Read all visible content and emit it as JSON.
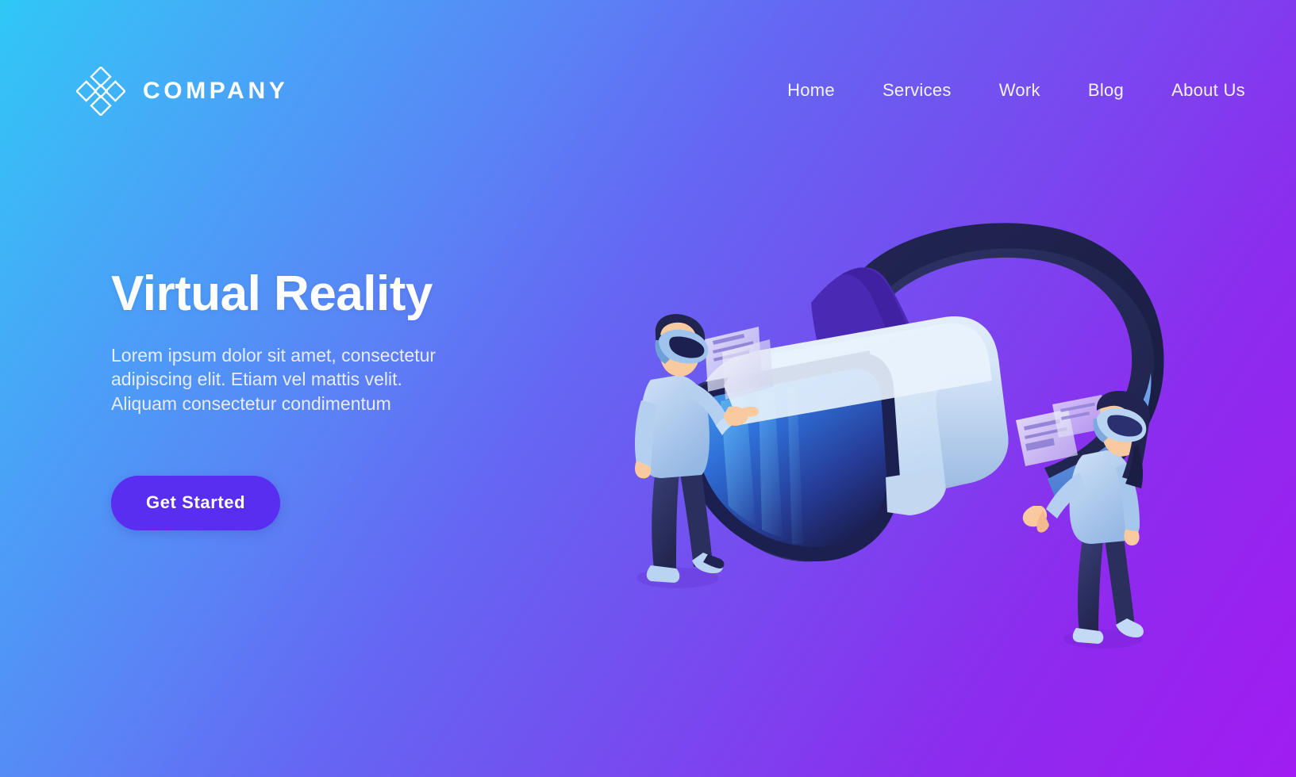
{
  "header": {
    "logo_icon": "diamond-cluster-logo-icon",
    "brand_name": "COMPANY",
    "nav_items": [
      {
        "label": "Home"
      },
      {
        "label": "Services"
      },
      {
        "label": "Work"
      },
      {
        "label": "Blog"
      },
      {
        "label": "About Us"
      }
    ]
  },
  "hero": {
    "title": "Virtual Reality",
    "description_line_1": "Lorem ipsum dolor sit amet, consectetur",
    "description_line_2": "adipiscing elit. Etiam vel mattis velit.",
    "description_line_3": "Aliquam consectetur condimentum",
    "cta_label": "Get Started"
  },
  "illustration": {
    "name": "isometric-virtual-reality-scene",
    "elements": [
      "vr-headset-large",
      "man-wearing-vr-headset",
      "woman-wearing-vr-headset",
      "floating-ui-card-left",
      "floating-ui-card-right"
    ]
  },
  "colors": {
    "gradient_start": "#2fc8f5",
    "gradient_mid": "#6468f3",
    "gradient_end": "#a11cf2",
    "accent_button": "#5a2ef0",
    "text_primary": "#ffffff",
    "text_secondary": "#e7ecfb",
    "hex_pattern": "rgba(60,20,150,0.085)"
  }
}
